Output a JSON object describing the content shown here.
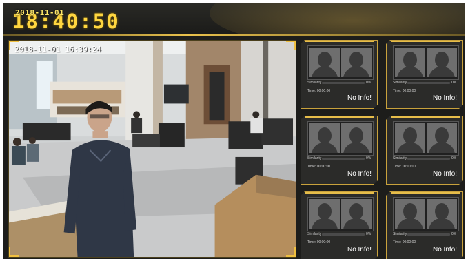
{
  "header": {
    "date": "2018-11-01",
    "clock": "18:40:50"
  },
  "video": {
    "timestamp": "2018-11-01 16:39:24"
  },
  "match_cards": [
    {
      "similarity_label": "Similarity",
      "similarity_value": "0%",
      "similarity_level": 0,
      "time": "Time: 00:00:00",
      "status": "No Info!"
    },
    {
      "similarity_label": "Similarity",
      "similarity_value": "0%",
      "similarity_level": 0,
      "time": "Time: 00:00:00",
      "status": "No Info!"
    },
    {
      "similarity_label": "Similarity",
      "similarity_value": "0%",
      "similarity_level": 0,
      "time": "Time: 00:00:00",
      "status": "No Info!"
    },
    {
      "similarity_label": "Similarity",
      "similarity_value": "0%",
      "similarity_level": 0,
      "time": "Time: 00:00:00",
      "status": "No Info!"
    },
    {
      "similarity_label": "Similarity",
      "similarity_value": "0%",
      "similarity_level": 0,
      "time": "Time: 00:00:00",
      "status": "No Info!"
    },
    {
      "similarity_label": "Similarity",
      "similarity_value": "0%",
      "similarity_level": 0,
      "time": "Time: 00:00:00",
      "status": "No Info!"
    }
  ],
  "colors": {
    "accent": "#e6bd4a",
    "clock": "#ffd640",
    "panel_bg": "#1d1d1b"
  }
}
